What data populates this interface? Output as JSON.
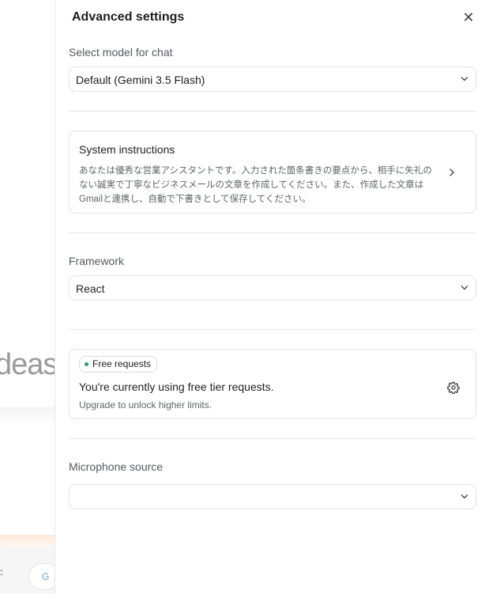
{
  "background": {
    "partial_heading": "deas",
    "chip_text": "c"
  },
  "panel": {
    "title": "Advanced settings",
    "model": {
      "label": "Select model for chat",
      "value": "Default (Gemini 3.5 Flash)"
    },
    "system_instructions": {
      "title": "System instructions",
      "text": "あなたは優秀な営業アシスタントです。入力された箇条書きの要点から、相手に失礼のない誠実で丁寧なビジネスメールの文章を作成してください。また、作成した文章はGmailと連携し、自動で下書きとして保存してください。"
    },
    "framework": {
      "label": "Framework",
      "value": "React"
    },
    "free_tier": {
      "badge": "Free requests",
      "message": "You're currently using free tier requests.",
      "sub": "Upgrade to unlock higher limits."
    },
    "microphone": {
      "label": "Microphone source",
      "value": ""
    }
  },
  "colors": {
    "status_dot": "#2e9e5b",
    "border": "#e3e3e3",
    "muted_text": "#5f6368"
  }
}
